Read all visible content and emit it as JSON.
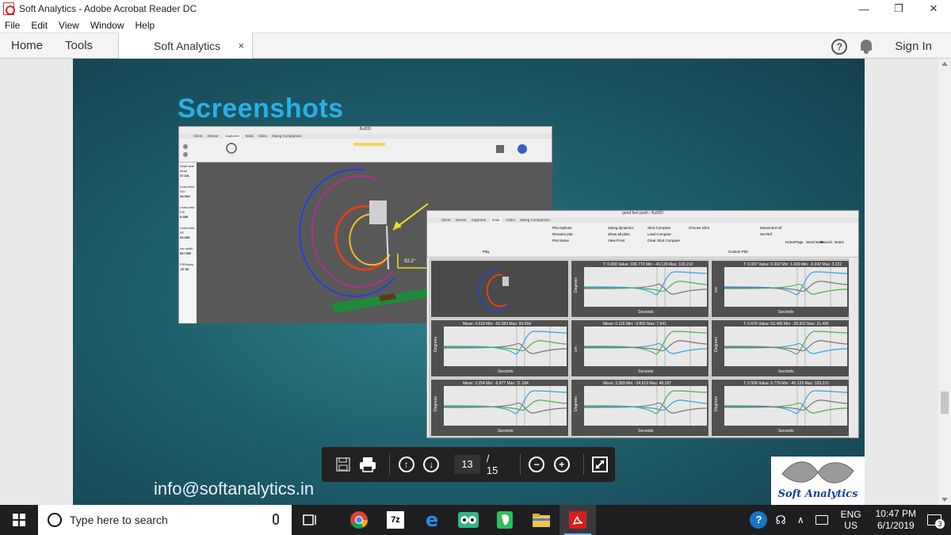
{
  "window": {
    "title": "Soft Analytics - Adobe Acrobat Reader DC"
  },
  "menu": [
    "File",
    "Edit",
    "View",
    "Window",
    "Help"
  ],
  "tabs": {
    "home": "Home",
    "tools": "Tools",
    "document": "Soft Analytics",
    "close": "×",
    "sign_in": "Sign In"
  },
  "slide": {
    "title": "Screenshots",
    "email": "info@softanalytics.in",
    "logo_text": "Soft Analytics",
    "shot1": {
      "title": "Bull3D",
      "tabs": [
        "Client",
        "Sensor",
        "Captures",
        "Data",
        "Video",
        "Swing Comparison"
      ],
      "readouts": [
        "Shaft side head",
        "37.32L",
        "Lead wrist R/U",
        "28.06U",
        "Lead wrist F/E",
        "0.05E",
        "Lead wrist SF",
        "63.38S",
        "Arc width",
        "89.74W",
        "PSRotary",
        "-57.00"
      ],
      "angle_label": "92.2°"
    },
    "shot2": {
      "title": "good feel push - Bull3D",
      "tabs": [
        "Client",
        "Sensor",
        "Captures",
        "Data",
        "Video",
        "Swing Comparison"
      ],
      "ribbon": [
        "Plot Options",
        "Rename plot",
        "Plot Name",
        "Swing dynamics",
        "Show all plots",
        "View Front",
        "Shot Compare",
        "Load Compare",
        "Clear Shot Compare",
        "Choose Shot",
        "Movement ref",
        "Set Ref",
        "HomePage",
        "Send Notes",
        "Record",
        "Notes"
      ],
      "section_labels": [
        "Play",
        "Custom Plot"
      ],
      "plots": [
        {
          "stats": "T: 0.000  Value: 336.770  Min: -43.129  Max: 103.210",
          "ylabel": "Degrees"
        },
        {
          "stats": "T: 0.067  Value: 0.302  Min: 1.439  Min: -0.042  Max: 3.222",
          "ylabel": "cm"
        },
        {
          "stats": "Mean: 4.518  Min: -50.083  Max: 99.564",
          "ylabel": "Degrees"
        },
        {
          "stats": "Mean: 0.116  Min: -9.892  Max: 7.841",
          "ylabel": "cm"
        },
        {
          "stats": "T: 0.676  Value: 53.480  Min: -35.902  Max: 21.405",
          "ylabel": "Degrees"
        },
        {
          "stats": "Mean: 3.254  Min: -6.877  Max: 11.184",
          "ylabel": "Degrees"
        },
        {
          "stats": "Mean: 3.389  Min: -34.619  Max: 48.187",
          "ylabel": "Degrees"
        },
        {
          "stats": "T: 0.508  Value: 6.779  Min: -45.129  Max: 103.210",
          "ylabel": "Degrees"
        }
      ],
      "xlabel": "Seconds"
    }
  },
  "page_toolbar": {
    "current_page": "13",
    "total": "/ 15"
  },
  "taskbar": {
    "search_placeholder": "Type here to search",
    "lang_top": "ENG",
    "lang_bottom": "US",
    "time": "10:47 PM",
    "date": "6/1/2019",
    "notification_count": "3",
    "app_7z": "7z"
  },
  "colors": {
    "slide_bg": "#1f5f6d",
    "title_blue": "#2ab0e6",
    "taskbar": "#1f1f22"
  }
}
